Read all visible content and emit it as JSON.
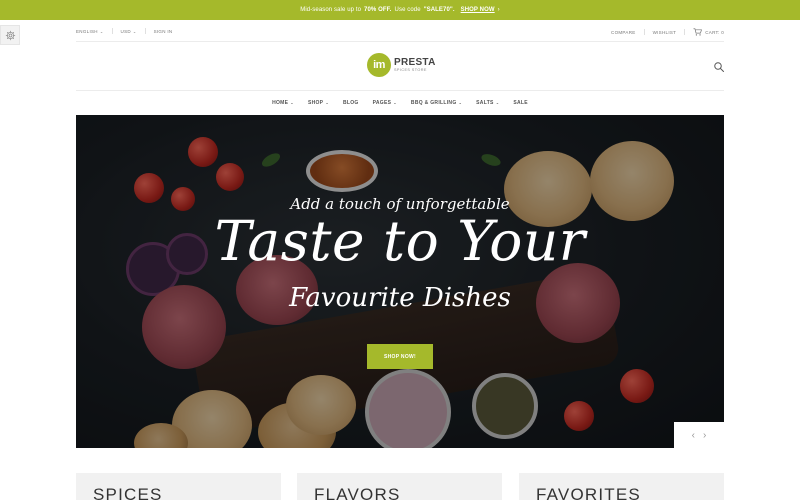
{
  "promo": {
    "text_before": "Mid-season sale up to",
    "discount": "70% OFF.",
    "text_code": "Use code",
    "code": "\"SALE70\".",
    "link": "SHOP NOW",
    "link_arrow": "›"
  },
  "topbar": {
    "language": "ENGLISH",
    "currency": "USD",
    "sign_in": "SIGN IN",
    "compare": "COMPARE",
    "wishlist": "WISHLIST",
    "cart": "CART: 0"
  },
  "logo": {
    "mark": "im",
    "name": "PRESTA",
    "tagline": "SPICES STORE"
  },
  "nav": {
    "items": [
      {
        "label": "HOME",
        "dropdown": true
      },
      {
        "label": "SHOP",
        "dropdown": true
      },
      {
        "label": "BLOG",
        "dropdown": false
      },
      {
        "label": "PAGES",
        "dropdown": true
      },
      {
        "label": "BBQ & GRILLING",
        "dropdown": true
      },
      {
        "label": "SALTS",
        "dropdown": true
      },
      {
        "label": "SALE",
        "dropdown": false
      }
    ]
  },
  "hero": {
    "pretitle": "Add a touch of unforgettable",
    "title": "Taste to Your",
    "subtitle": "Favourite Dishes",
    "button": "SHOP NOW!",
    "prev": "‹",
    "next": "›"
  },
  "categories": [
    {
      "label": "SPICES"
    },
    {
      "label": "FLAVORS"
    },
    {
      "label": "FAVORITES"
    }
  ],
  "colors": {
    "accent": "#a5b92b"
  },
  "icons": {
    "settings": "gear-icon",
    "search": "search-icon",
    "cart": "cart-icon"
  }
}
